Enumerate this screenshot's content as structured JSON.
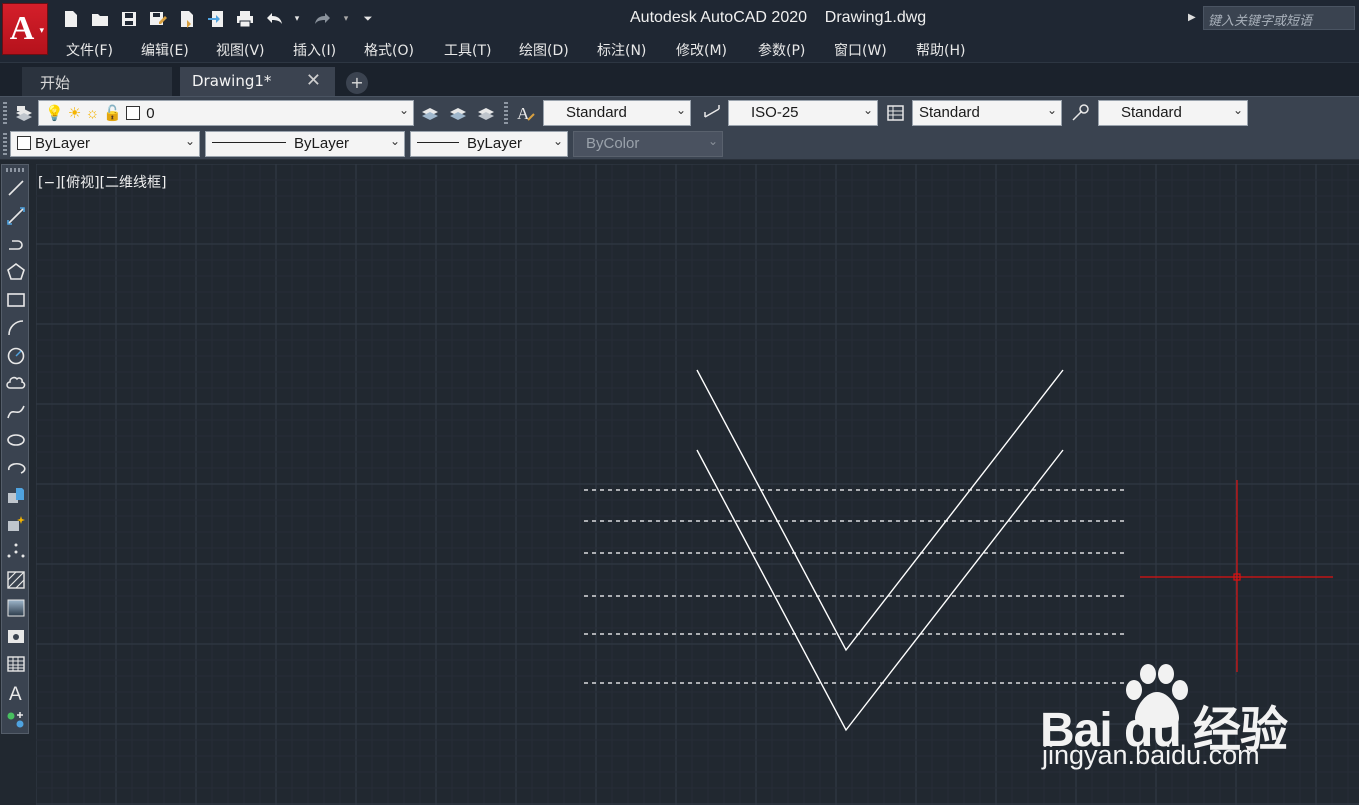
{
  "app": {
    "logo_letter": "A",
    "title": "Autodesk AutoCAD 2020    Drawing1.dwg",
    "search_placeholder": "键入关键字或短语"
  },
  "quick_access": [
    "new-icon",
    "open-icon",
    "save-icon",
    "save-as-icon",
    "publish-icon",
    "export-icon",
    "plot-icon",
    "undo-icon",
    "redo-icon",
    "customize-icon"
  ],
  "menu": [
    "文件(F)",
    "编辑(E)",
    "视图(V)",
    "插入(I)",
    "格式(O)",
    "工具(T)",
    "绘图(D)",
    "标注(N)",
    "修改(M)",
    "参数(P)",
    "窗口(W)",
    "帮助(H)"
  ],
  "tabs": {
    "start": "开始",
    "drawing": "Drawing1*",
    "close": "✕",
    "add": "+"
  },
  "toolbar1": {
    "layer": "0",
    "text_style": "Standard",
    "dim_style": "ISO-25",
    "table_style": "Standard",
    "multileader_style": "Standard"
  },
  "toolbar2": {
    "color": "ByLayer",
    "linetype": "ByLayer",
    "lineweight": "ByLayer",
    "plot_style": "ByColor"
  },
  "palette_tools": [
    "line-icon",
    "construction-line-icon",
    "polyline-icon",
    "polygon-icon",
    "rectangle-icon",
    "arc-icon",
    "circle-icon",
    "revision-cloud-icon",
    "spline-icon",
    "ellipse-icon",
    "ellipse-arc-icon",
    "insert-block-icon",
    "make-block-icon",
    "point-icon",
    "hatch-icon",
    "gradient-icon",
    "region-icon",
    "table-icon",
    "multiline-text-icon",
    "add-selected-icon"
  ],
  "viewport": {
    "label": "[−][俯视][二维线框]"
  },
  "colors": {
    "background": "#212830",
    "crosshair": "#e01010",
    "lines": "#ffffff"
  },
  "watermark": {
    "text": "Bai  du 经验",
    "url": "jingyan.baidu.com"
  }
}
